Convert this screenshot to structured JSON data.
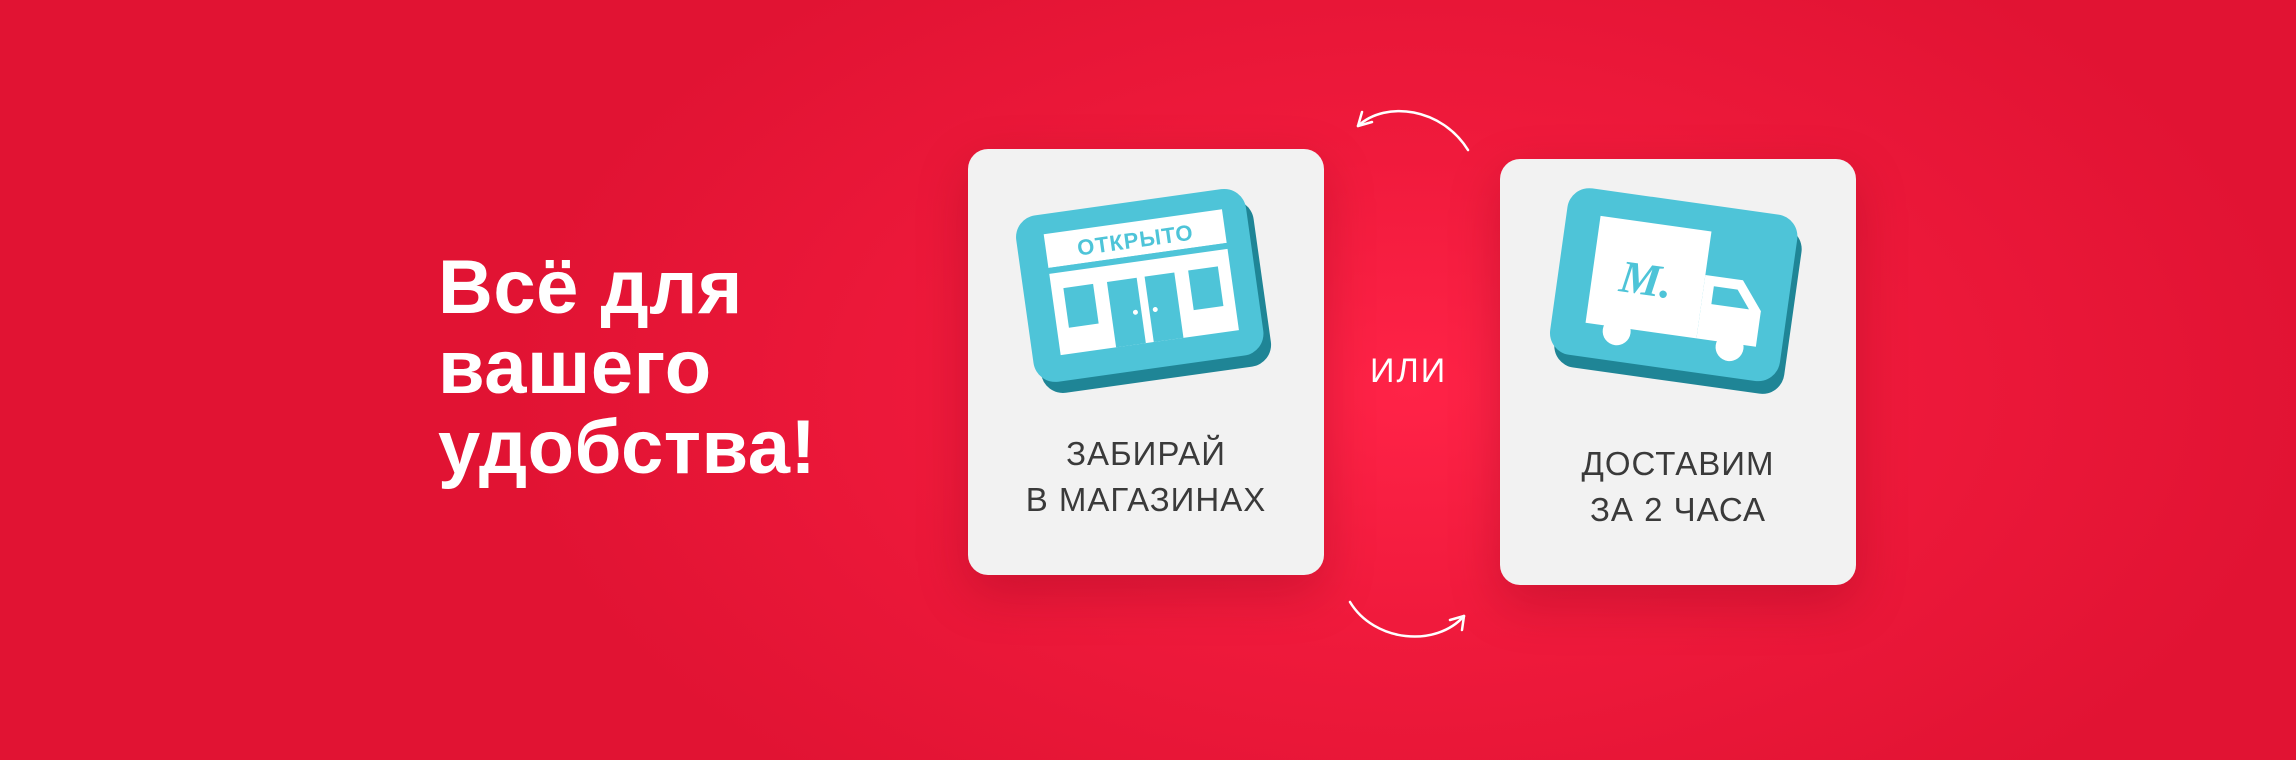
{
  "headline": {
    "lines": [
      "Всё для",
      "вашего",
      "удобства!"
    ]
  },
  "options": [
    {
      "icon": "store-icon",
      "sign_text": "ОТКРЫТО",
      "caption_lines": [
        "ЗАБИРАЙ",
        "В МАГАЗИНАХ"
      ]
    },
    {
      "icon": "delivery-truck-icon",
      "logo_text": "М.",
      "caption_lines": [
        "ДОСТАВИМ",
        "ЗА 2 ЧАСА"
      ]
    }
  ],
  "separator": {
    "label": "ИЛИ"
  },
  "colors": {
    "background": "#e8163a",
    "card": "#f2f2f2",
    "icon_accent": "#4ec4d8",
    "icon_shadow": "#1f8596",
    "text_dark": "#3a3a3a",
    "text_light": "#ffffff"
  }
}
